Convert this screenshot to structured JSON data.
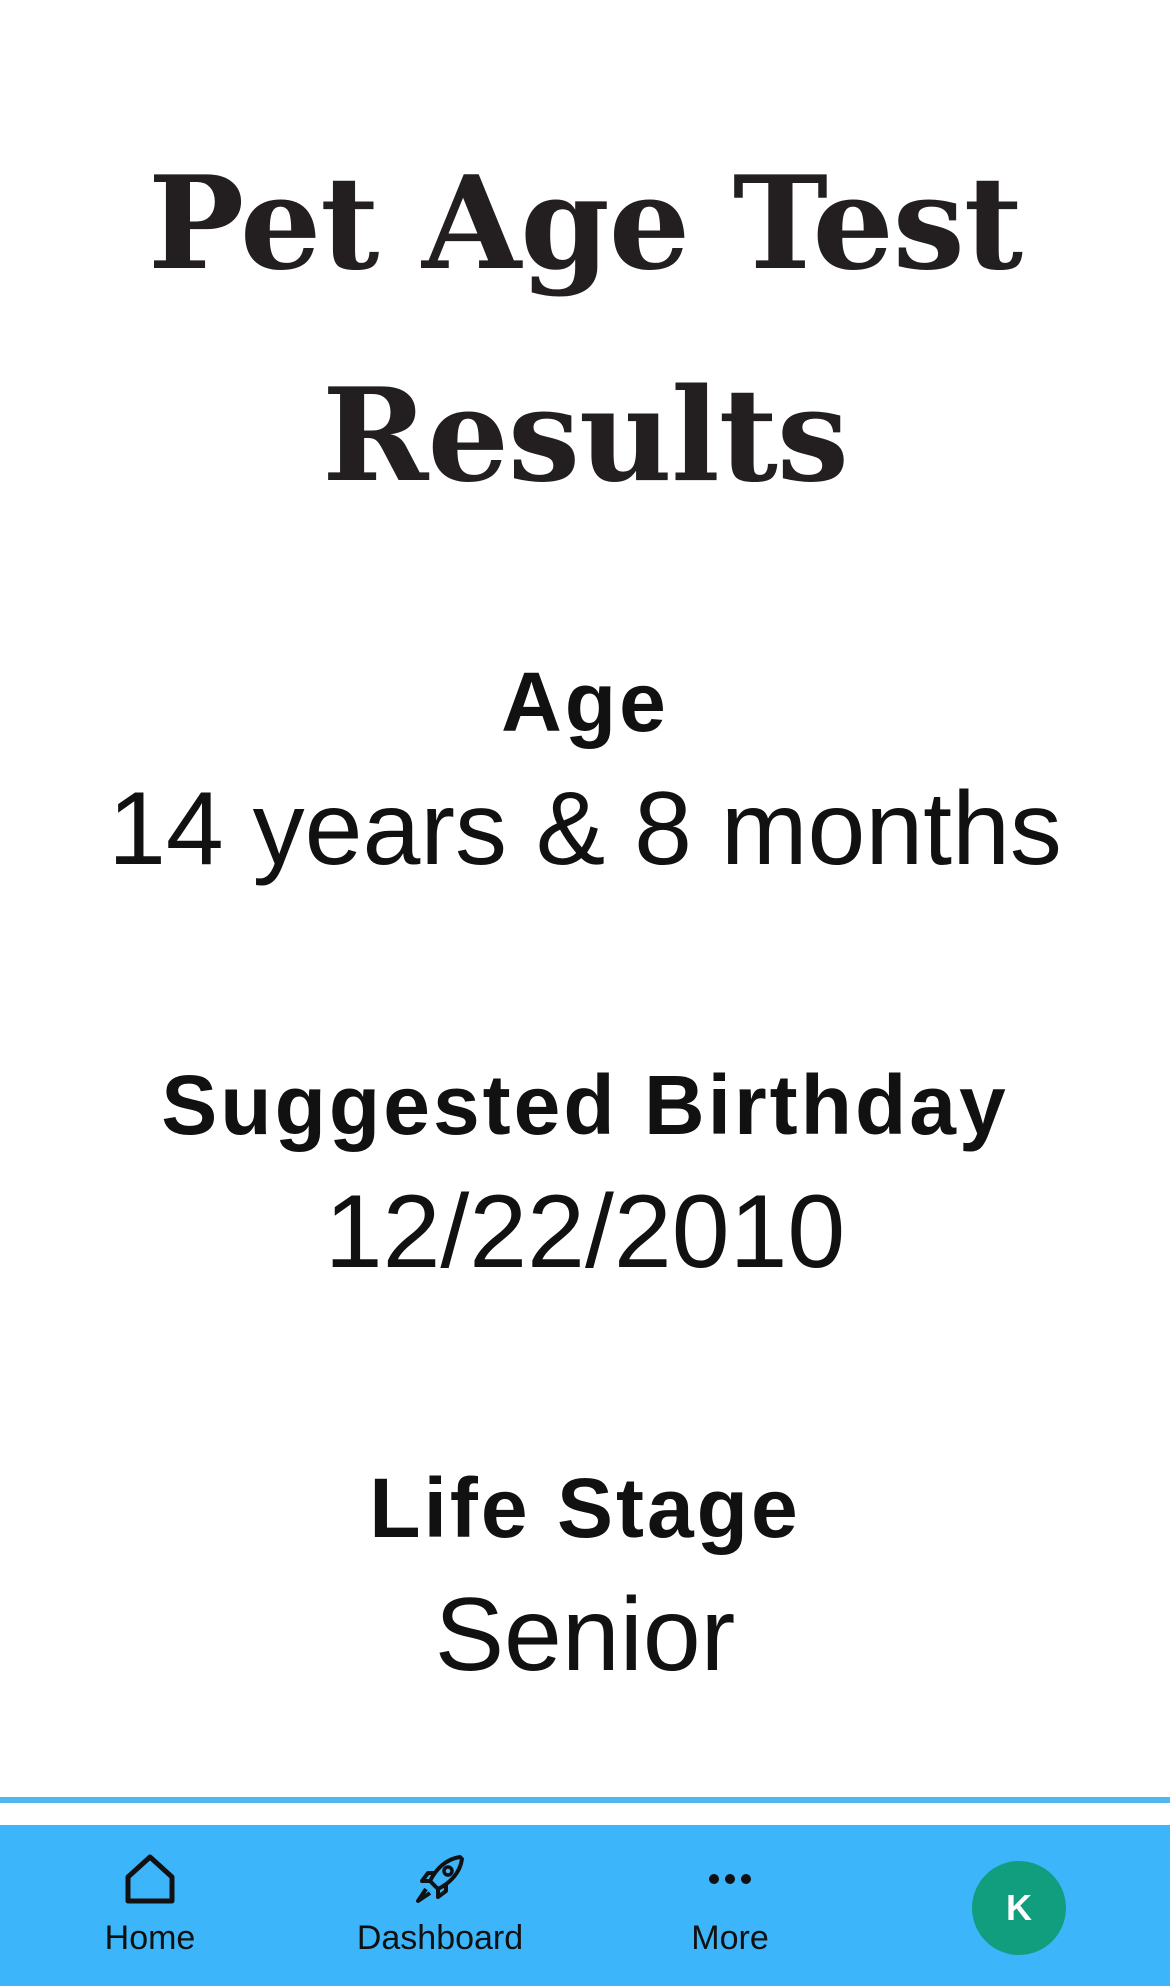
{
  "page": {
    "title": "Pet Age Test Results"
  },
  "results": {
    "age": {
      "label": "Age",
      "value": "14 years & 8 months"
    },
    "birthday": {
      "label": "Suggested Birthday",
      "value": "12/22/2010"
    },
    "life_stage": {
      "label": "Life Stage",
      "value": "Senior"
    }
  },
  "bottom_nav": {
    "items": [
      {
        "label": "Home",
        "icon": "home-icon"
      },
      {
        "label": "Dashboard",
        "icon": "rocket-icon"
      },
      {
        "label": "More",
        "icon": "more-dots-icon"
      }
    ],
    "avatar_initial": "K"
  },
  "colors": {
    "nav_background": "#3db5fb",
    "avatar_background": "#119e7e",
    "text": "#111111"
  }
}
